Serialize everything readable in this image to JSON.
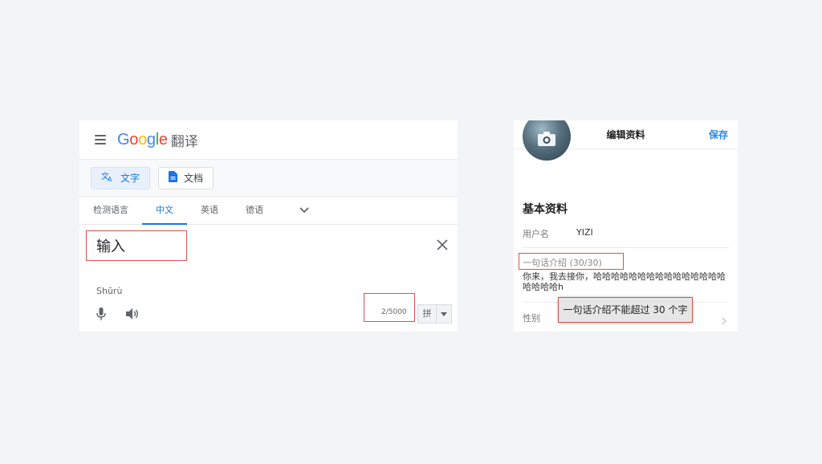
{
  "translate": {
    "logo": {
      "G": "G",
      "o1": "o",
      "o2": "o",
      "g": "g",
      "l": "l",
      "e": "e"
    },
    "product": "翻译",
    "modes": [
      {
        "label": "文字",
        "icon": "translate-icon",
        "active": true
      },
      {
        "label": "文档",
        "icon": "document-icon",
        "active": false
      }
    ],
    "languages": [
      "检测语言",
      "中文",
      "英语",
      "德语"
    ],
    "active_language": "中文",
    "input_text": "输入",
    "romanization": "Shūrù",
    "char_count": "2/5000",
    "ime_label": "拼",
    "colors": {
      "accent": "#1a73e8",
      "highlight": "#d9534f"
    }
  },
  "profile": {
    "nav": {
      "title": "编辑资料",
      "save_label": "保存"
    },
    "section_title": "基本资料",
    "username_label": "用户名",
    "username_value": "YIZI",
    "intro_label": "一句话介绍 (30/30)",
    "intro_text": "你来，我去接你，哈哈哈哈哈哈哈哈哈哈哈哈哈哈哈哈哈哈哈h",
    "gender_label": "性别",
    "toast": "一句话介绍不能超过 30 个字",
    "colors": {
      "accent": "#2a85e8"
    }
  }
}
